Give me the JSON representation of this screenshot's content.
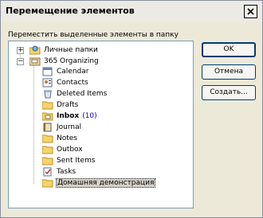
{
  "window": {
    "title": "Перемещение элементов"
  },
  "prompt": "Переместить выделенные элементы в папку",
  "tree": {
    "roots": [
      {
        "label": "Личные папки",
        "icon": "folder-globe-icon",
        "expander": "+"
      },
      {
        "label": "365 Organizing",
        "icon": "mailbox-icon",
        "expander": "−"
      }
    ],
    "items": [
      {
        "label": "Calendar",
        "icon": "calendar-icon",
        "bold": false,
        "count": ""
      },
      {
        "label": "Contacts",
        "icon": "contacts-icon",
        "bold": false,
        "count": ""
      },
      {
        "label": "Deleted Items",
        "icon": "deleted-items-icon",
        "bold": false,
        "count": ""
      },
      {
        "label": "Drafts",
        "icon": "folder-icon",
        "bold": false,
        "count": ""
      },
      {
        "label": "Inbox",
        "icon": "inbox-icon",
        "bold": true,
        "count": "(10)"
      },
      {
        "label": "Journal",
        "icon": "journal-icon",
        "bold": false,
        "count": ""
      },
      {
        "label": "Notes",
        "icon": "folder-icon",
        "bold": false,
        "count": ""
      },
      {
        "label": "Outbox",
        "icon": "folder-icon",
        "bold": false,
        "count": ""
      },
      {
        "label": "Sent Items",
        "icon": "folder-icon",
        "bold": false,
        "count": ""
      },
      {
        "label": "Tasks",
        "icon": "tasks-icon",
        "bold": false,
        "count": ""
      },
      {
        "label": "Домашняя демонстрация",
        "icon": "folder-icon",
        "bold": false,
        "count": "",
        "selected": true
      }
    ]
  },
  "buttons": {
    "ok": "OK",
    "cancel": "Отмена",
    "create": "Создать..."
  },
  "colors": {
    "accent": "#003c74",
    "count": "#0000c0"
  }
}
